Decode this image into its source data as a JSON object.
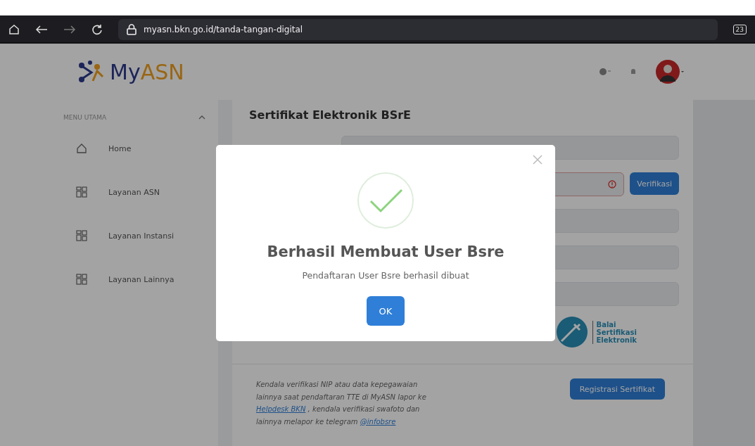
{
  "browser": {
    "url": "myasn.bkn.go.id/tanda-tangan-digital",
    "tab_count": "23"
  },
  "header": {
    "logo": [
      {
        "text": "My",
        "kind": "primary"
      },
      {
        "text": "ASN",
        "kind": "accent"
      }
    ]
  },
  "sidebar": {
    "section": "MENU UTAMA",
    "expanded": true,
    "items": [
      {
        "label": "Home",
        "kind": "home"
      },
      {
        "label": "Layanan ASN",
        "kind": "grid"
      },
      {
        "label": "Layanan Instansi",
        "kind": "grid"
      },
      {
        "label": "Layanan Lainnya",
        "kind": "grid"
      }
    ]
  },
  "content": {
    "title": "Sertifikat Elektronik BSrE",
    "fields": [
      {
        "kind": "plain"
      },
      {
        "kind": "verify",
        "button": "Verifikasi"
      },
      {
        "kind": "plain"
      },
      {
        "kind": "plain"
      },
      {
        "kind": "plain"
      }
    ],
    "partner_logo": [
      "Balai",
      "Sertifikasi",
      "Elektronik"
    ],
    "notice": [
      {
        "kind": "text",
        "text": "Kendala verifikasi NIP atau data kepegawaian lainnya saat pendaftaran TTE di MyASN lapor ke "
      },
      {
        "kind": "link",
        "text": "Helpdesk BKN"
      },
      {
        "kind": "text",
        "text": " , kendala verifikasi swafoto dan lainnya melapor ke telegram "
      },
      {
        "kind": "link",
        "text": "@infobsre"
      }
    ],
    "register_button": "Registrasi Sertifikat"
  },
  "dialog": {
    "title": "Berhasil Membuat User Bsre",
    "message": "Pendaftaran User Bsre berhasil dibuat",
    "button": "OK"
  }
}
